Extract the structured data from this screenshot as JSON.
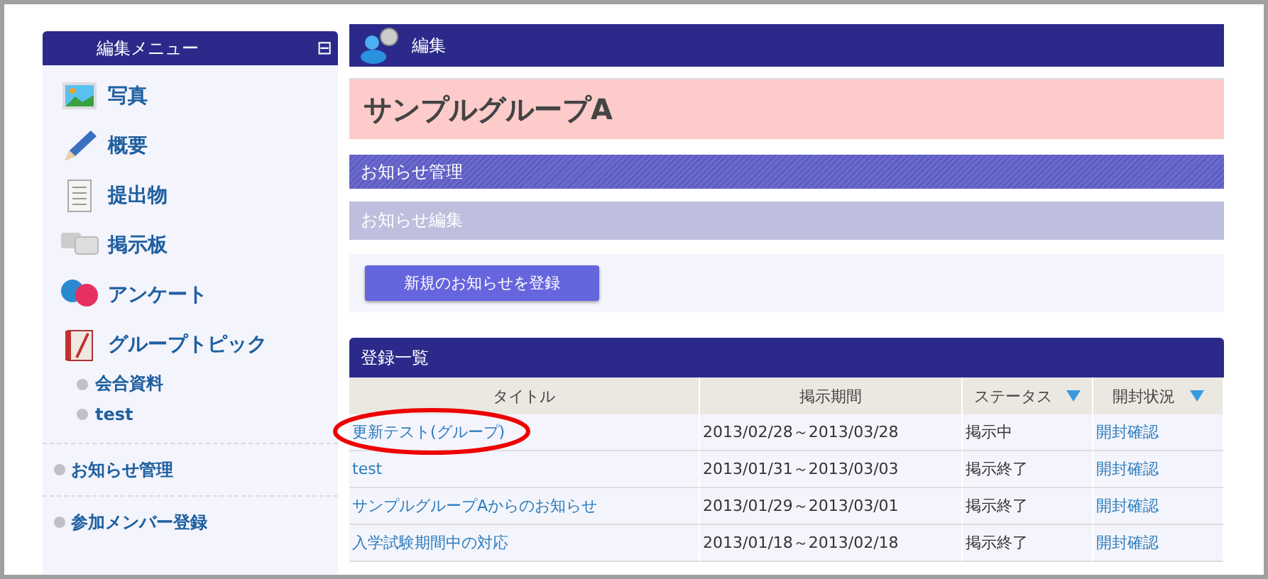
{
  "sidebar": {
    "title": "編集メニュー",
    "collapse_icon": "⊟",
    "items": [
      {
        "kind": "photo",
        "label": "写真"
      },
      {
        "kind": "pencil",
        "label": "概要"
      },
      {
        "kind": "document",
        "label": "提出物"
      },
      {
        "kind": "chat",
        "label": "掲示板"
      },
      {
        "kind": "qa",
        "label": "アンケート"
      },
      {
        "kind": "book",
        "label": "グループトピック",
        "children": [
          {
            "label": "会合資料"
          },
          {
            "label": "test"
          }
        ]
      }
    ],
    "links": [
      {
        "label": "お知らせ管理"
      },
      {
        "label": "参加メンバー登録"
      }
    ]
  },
  "main": {
    "header": "編集",
    "group_name": "サンプルグループA",
    "section_bar": "お知らせ管理",
    "sub_bar": "お知らせ編集",
    "register_button": "新規のお知らせを登録",
    "list": {
      "title": "登録一覧",
      "columns": [
        {
          "label": "タイトル",
          "sortable": false
        },
        {
          "label": "掲示期間",
          "sortable": false
        },
        {
          "label": "ステータス",
          "sortable": true
        },
        {
          "label": "開封状況",
          "sortable": true
        }
      ],
      "rows": [
        {
          "title": "更新テスト(グループ)",
          "period": "2013/02/28～2013/03/28",
          "status": "掲示中",
          "open": "開封確認",
          "circled": true
        },
        {
          "title": "test",
          "period": "2013/01/31～2013/03/03",
          "status": "掲示終了",
          "open": "開封確認",
          "circled": false
        },
        {
          "title": "サンプルグループAからのお知らせ",
          "period": "2013/01/29～2013/03/01",
          "status": "掲示終了",
          "open": "開封確認",
          "circled": false
        },
        {
          "title": "入学試験期間中の対応",
          "period": "2013/01/18～2013/02/18",
          "status": "掲示終了",
          "open": "開封確認",
          "circled": false
        }
      ]
    }
  }
}
